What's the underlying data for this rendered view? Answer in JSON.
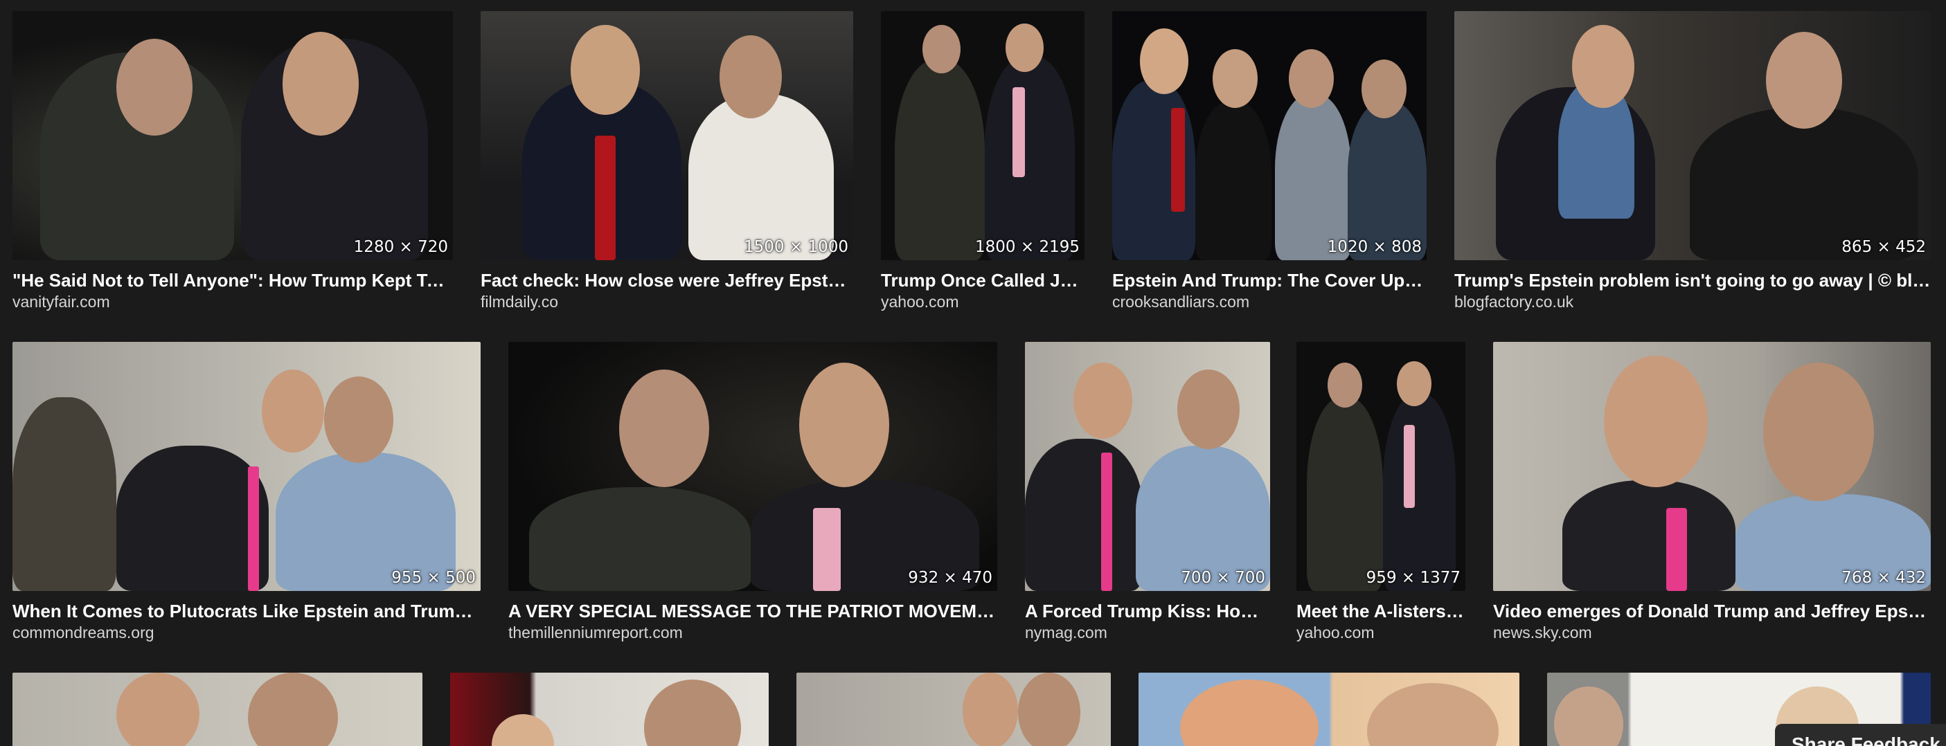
{
  "results": [
    {
      "title": "\"He Said Not to Tell Anyone\": How Trump Kept Tabs ...",
      "source": "vanityfair.com",
      "dims": "1280 × 720"
    },
    {
      "title": "Fact check: How close were Jeffrey Epstein ...",
      "source": "filmdaily.co",
      "dims": "1500 × 1000"
    },
    {
      "title": "Trump Once Called Jef...",
      "source": "yahoo.com",
      "dims": "1800 × 2195"
    },
    {
      "title": "Epstein And Trump: The Cover Up A...",
      "source": "crooksandliars.com",
      "dims": "1020 × 808"
    },
    {
      "title": "Trump's Epstein problem isn't going to go away | © blogf...",
      "source": "blogfactory.co.uk",
      "dims": "865 × 452"
    },
    {
      "title": "When It Comes to Plutocrats Like Epstein and Trump, Al...",
      "source": "commondreams.org",
      "dims": "955 × 500"
    },
    {
      "title": "A VERY SPECIAL MESSAGE TO THE PATRIOT MOVEMENT...",
      "source": "themillenniumreport.com",
      "dims": "932 × 470"
    },
    {
      "title": "A Forced Trump Kiss: How ...",
      "source": "nymag.com",
      "dims": "700 × 700"
    },
    {
      "title": "Meet the A-listers i...",
      "source": "yahoo.com",
      "dims": "959 × 1377"
    },
    {
      "title": "Video emerges of Donald Trump and Jeffrey Epstei...",
      "source": "news.sky.com",
      "dims": "768 × 432"
    }
  ],
  "feedback_label": "Share Feedback"
}
